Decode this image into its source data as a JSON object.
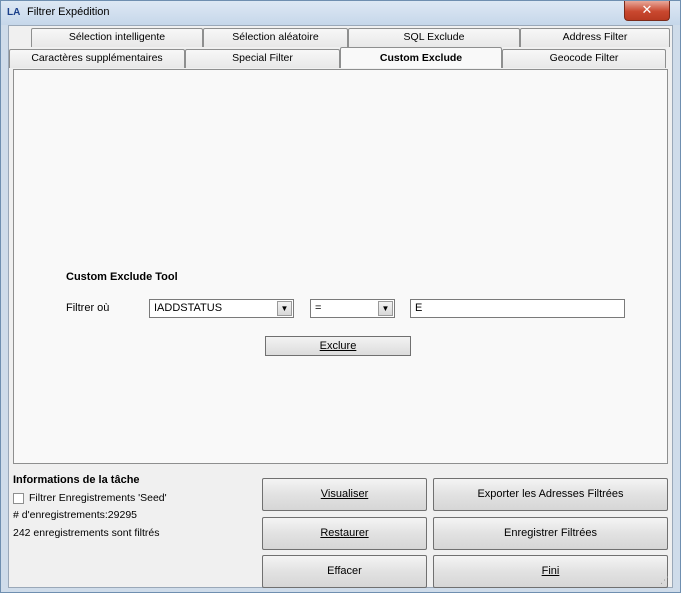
{
  "window": {
    "title": "Filtrer Expédition",
    "icon_text": "LA",
    "close_glyph": "✕"
  },
  "tabs": {
    "row_back": [
      {
        "label": "Sélection intelligente"
      },
      {
        "label": "Sélection aléatoire"
      },
      {
        "label": "SQL Exclude"
      },
      {
        "label": "Address Filter"
      }
    ],
    "row_front": [
      {
        "label": "Caractères supplémentaires"
      },
      {
        "label": "Special Filter"
      },
      {
        "label": "Custom Exclude",
        "active": true
      },
      {
        "label": "Geocode Filter"
      }
    ]
  },
  "custom_exclude": {
    "tool_title": "Custom Exclude Tool",
    "filter_label": "Filtrer où",
    "field_value": "IADDSTATUS",
    "operator_value": "=",
    "text_value": "E",
    "exclude_button": "Exclure"
  },
  "task_info": {
    "title": "Informations de la tâche",
    "checkbox_label": "Filtrer Enregistrements 'Seed'",
    "checkbox_checked": false,
    "record_count": "# d'enregistrements:29295",
    "filtered_count": "242 enregistrements sont filtrés"
  },
  "buttons": {
    "visualiser": "Visualiser",
    "exporter": "Exporter les Adresses Filtrées",
    "restaurer": "Restaurer",
    "enregistrer": "Enregistrer Filtrées",
    "effacer": "Effacer",
    "fini": "Fini"
  },
  "icons": {
    "dropdown": "▼",
    "grip": "⋰"
  },
  "colors": {
    "titlebar": "#c6d7ea",
    "close_button": "#c9482f",
    "panel_bg": "#f9f9f9"
  }
}
